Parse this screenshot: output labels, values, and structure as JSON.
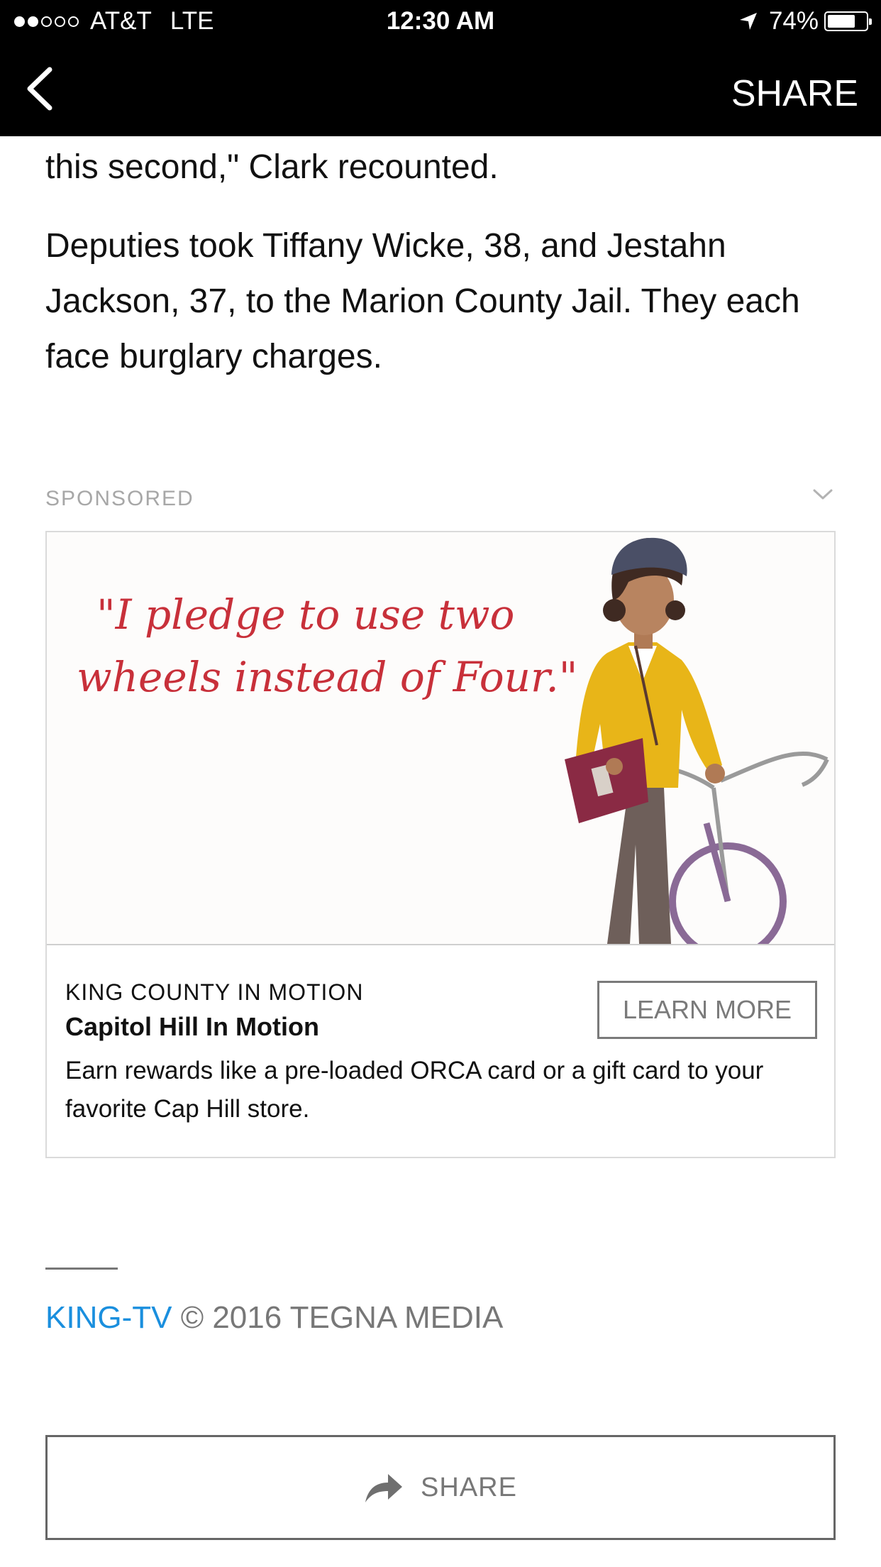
{
  "status_bar": {
    "carrier": "AT&T",
    "network": "LTE",
    "time": "12:30 AM",
    "battery_percent": "74%",
    "battery_level": 0.74,
    "signal_bars_filled": 2,
    "signal_bars_total": 5
  },
  "nav": {
    "back_icon": "chevron-left-icon",
    "share_label": "SHARE"
  },
  "article": {
    "paragraph_1": "this second,\" Clark recounted.",
    "paragraph_2": "Deputies took Tiffany Wicke, 38, and Jestahn Jackson, 37, to the Marion County Jail. They each face burglary charges."
  },
  "sponsored": {
    "label": "SPONSORED",
    "image_quote_line_1": "\"I pledge to use two",
    "image_quote_line_2": "wheels instead of Four.\"",
    "sponsor": "KING COUNTY IN MOTION",
    "title": "Capitol Hill In Motion",
    "description": "Earn rewards like a pre-loaded ORCA card or a gift card to your favorite Cap Hill store.",
    "cta": "LEARN MORE"
  },
  "footer": {
    "brand": "KING-TV",
    "copyright": "© 2016 TEGNA MEDIA",
    "share_label": "SHARE"
  },
  "colors": {
    "bar_background": "#000000",
    "link_blue": "#1a8fde",
    "quote_red": "#c8303a",
    "jacket_yellow": "#e8b518",
    "muted_gray": "#777777"
  }
}
